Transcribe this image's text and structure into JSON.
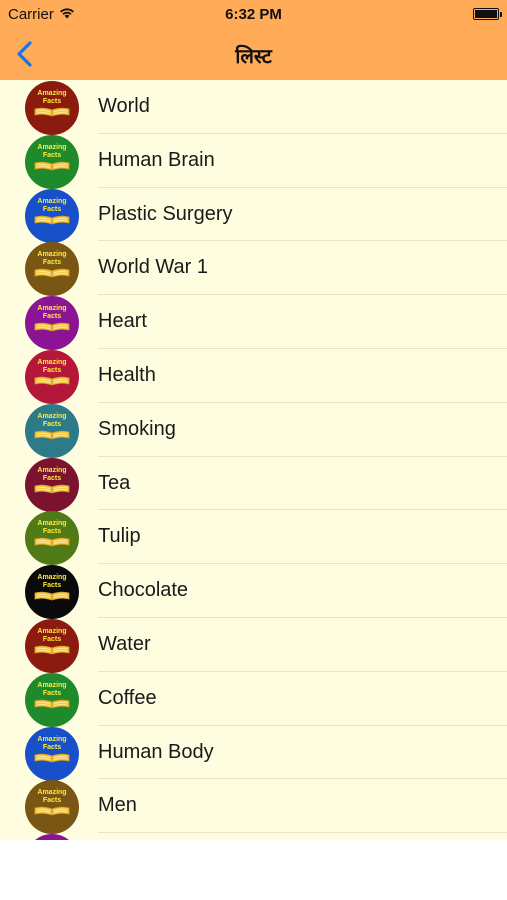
{
  "status": {
    "carrier": "Carrier",
    "time": "6:32 PM",
    "battery_level": 1.0,
    "icons": [
      "wifi-icon",
      "battery-icon"
    ]
  },
  "nav": {
    "title": "लिस्ट",
    "back_icon": "chevron-left-icon"
  },
  "colors": {
    "nav_bar": "#ffab57",
    "list_background": "#fffde0",
    "back_arrow": "#1a73e8"
  },
  "badge": {
    "line1": "Amazing",
    "line2": "Facts"
  },
  "items": [
    {
      "label": "World",
      "color": "#8b1a0f"
    },
    {
      "label": "Human Brain",
      "color": "#1f8a2c"
    },
    {
      "label": "Plastic Surgery",
      "color": "#1750c8"
    },
    {
      "label": "World War 1",
      "color": "#7a5614"
    },
    {
      "label": "Heart",
      "color": "#8a1494"
    },
    {
      "label": "Health",
      "color": "#b5173b"
    },
    {
      "label": "Smoking",
      "color": "#2d7a88"
    },
    {
      "label": "Tea",
      "color": "#7a1230"
    },
    {
      "label": "Tulip",
      "color": "#4f7a15"
    },
    {
      "label": "Chocolate",
      "color": "#0a0a0a"
    },
    {
      "label": "Water",
      "color": "#8b1a0f"
    },
    {
      "label": "Coffee",
      "color": "#1f8a2c"
    },
    {
      "label": "Human Body",
      "color": "#1750c8"
    },
    {
      "label": "Men",
      "color": "#7a5614"
    },
    {
      "label": "",
      "color": "#8a1494"
    }
  ]
}
